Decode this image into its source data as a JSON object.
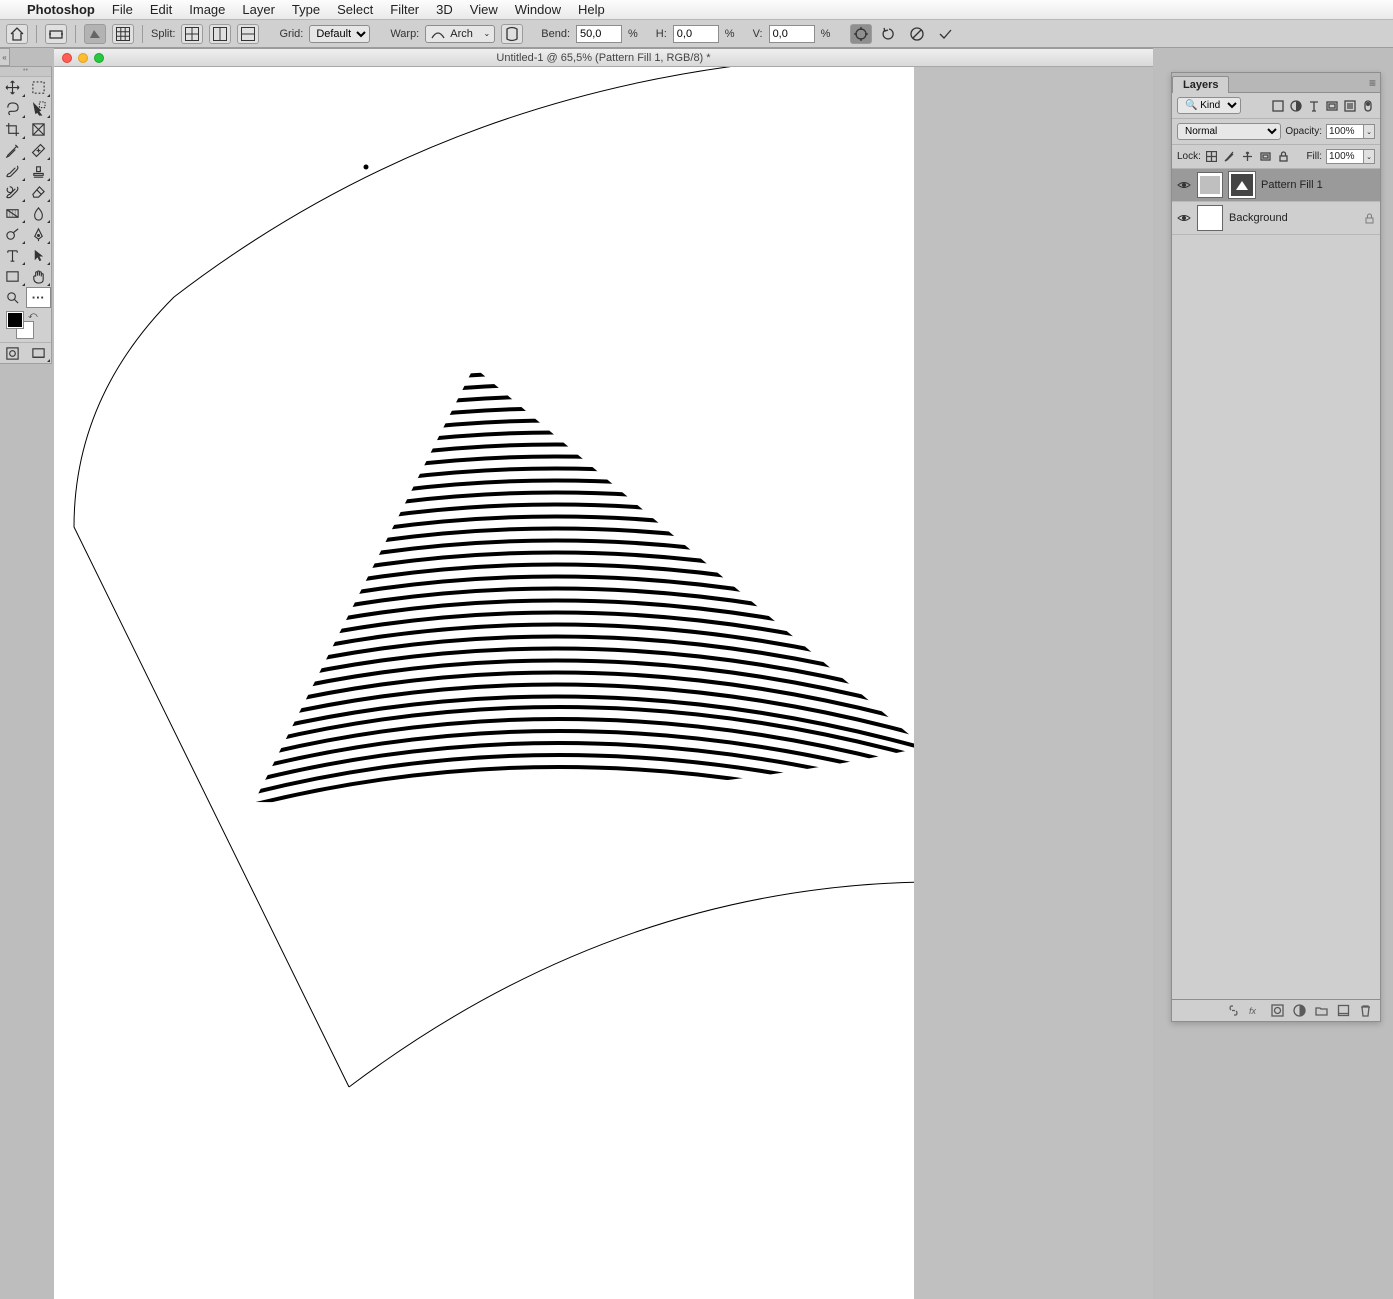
{
  "menubar": {
    "app": "Photoshop",
    "items": [
      "File",
      "Edit",
      "Image",
      "Layer",
      "Type",
      "Select",
      "Filter",
      "3D",
      "View",
      "Window",
      "Help"
    ]
  },
  "options": {
    "split_label": "Split:",
    "grid_label": "Grid:",
    "grid_value": "Default",
    "warp_label": "Warp:",
    "warp_style": "Arch",
    "bend_label": "Bend:",
    "bend_value": "50,0",
    "pct": "%",
    "h_label": "H:",
    "h_value": "0,0",
    "v_label": "V:",
    "v_value": "0,0"
  },
  "document": {
    "title": "Untitled-1 @ 65,5% (Pattern Fill 1, RGB/8) *"
  },
  "layers_panel": {
    "title": "Layers",
    "kind_label": "Kind",
    "blend_mode": "Normal",
    "opacity_label": "Opacity:",
    "opacity_value": "100%",
    "lock_label": "Lock:",
    "fill_label": "Fill:",
    "fill_value": "100%",
    "layers": [
      {
        "name": "Pattern Fill 1",
        "selected": true,
        "locked": false,
        "has_mask": true
      },
      {
        "name": "Background",
        "selected": false,
        "locked": true,
        "has_mask": false
      }
    ]
  }
}
